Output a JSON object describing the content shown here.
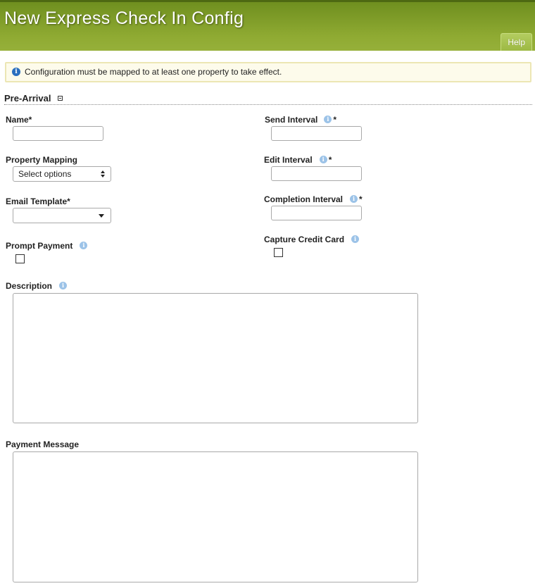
{
  "header": {
    "title": "New Express Check In Config",
    "help_label": "Help"
  },
  "notice": {
    "icon": "info-icon",
    "text": "Configuration must be mapped to at least one property to take effect."
  },
  "section": {
    "title": "Pre-Arrival",
    "collapse_icon": "collapse-minus-icon"
  },
  "fields": {
    "name": {
      "label": "Name*",
      "value": ""
    },
    "property_mapping": {
      "label": "Property Mapping",
      "selected": "Select options"
    },
    "email_template": {
      "label": "Email Template*",
      "selected": ""
    },
    "prompt_payment": {
      "label": "Prompt Payment",
      "checked": false
    },
    "send_interval": {
      "label": "Send Interval",
      "required_mark": "*",
      "value": ""
    },
    "edit_interval": {
      "label": "Edit Interval",
      "required_mark": "*",
      "value": ""
    },
    "completion_interval": {
      "label": "Completion Interval",
      "required_mark": "*",
      "value": ""
    },
    "capture_credit_card": {
      "label": "Capture Credit Card",
      "checked": false
    },
    "description": {
      "label": "Description",
      "value": ""
    },
    "payment_message": {
      "label": "Payment Message",
      "value": ""
    }
  },
  "colors": {
    "header_green": "#8faa32",
    "notice_bg": "#fdfbeb",
    "info_blue": "#2a6fbf",
    "hint_blue": "#9cc3e8"
  }
}
